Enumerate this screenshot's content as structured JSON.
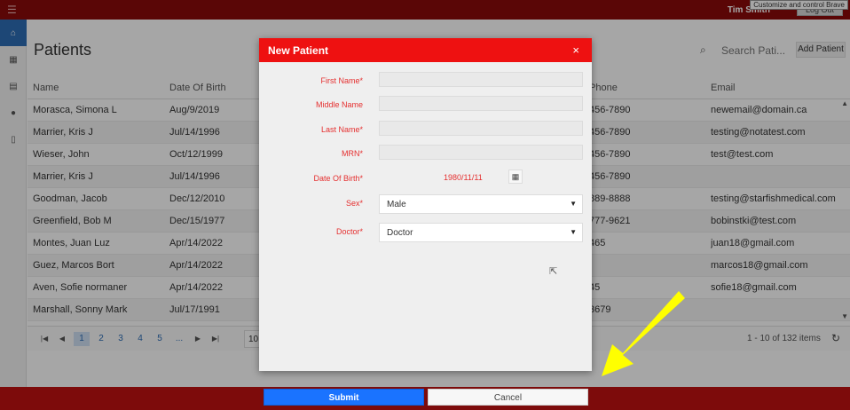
{
  "topbar": {
    "menu_icon": "hamburger-icon",
    "user_name": "Tim Smith",
    "logout_label": "Log Out",
    "tooltip": "Customize and control Brave",
    "color": "#8b0a0a"
  },
  "sidebar": {
    "items": [
      {
        "icon": "patients-icon",
        "glyph": "⌂",
        "active": true
      },
      {
        "icon": "calendar-icon",
        "glyph": "▦"
      },
      {
        "icon": "calculator-icon",
        "glyph": "▤"
      },
      {
        "icon": "user-icon",
        "glyph": "👤"
      },
      {
        "icon": "document-icon",
        "glyph": "▯"
      }
    ]
  },
  "main": {
    "title": "Patients",
    "search_placeholder": "Search Pati...",
    "add_patient_label": "Add Patient"
  },
  "grid": {
    "columns": {
      "name": "Name",
      "dob": "Date Of Birth",
      "phone": "Phone",
      "email": "Email"
    },
    "rows": [
      {
        "name": "Morasca, Simona L",
        "dob": "Aug/9/2019",
        "phone": "456-7890",
        "email": "newemail@domain.ca"
      },
      {
        "name": "Marrier, Kris J",
        "dob": "Jul/14/1996",
        "phone": "456-7890",
        "email": "testing@notatest.com"
      },
      {
        "name": "Wieser, John",
        "dob": "Oct/12/1999",
        "phone": "456-7890",
        "email": "test@test.com"
      },
      {
        "name": "Marrier, Kris J",
        "dob": "Jul/14/1996",
        "phone": "456-7890",
        "email": ""
      },
      {
        "name": "Goodman, Jacob",
        "dob": "Dec/12/2010",
        "phone": "889-8888",
        "email": "testing@starfishmedical.com"
      },
      {
        "name": "Greenfield, Bob M",
        "dob": "Dec/15/1977",
        "phone": "777-9621",
        "email": "bobinstki@test.com"
      },
      {
        "name": "Montes, Juan Luz",
        "dob": "Apr/14/2022",
        "phone": "465",
        "email": "juan18@gmail.com"
      },
      {
        "name": "Guez, Marcos Bort",
        "dob": "Apr/14/2022",
        "phone": "",
        "email": "marcos18@gmail.com"
      },
      {
        "name": "Aven, Sofie normaner",
        "dob": "Apr/14/2022",
        "phone": "45",
        "email": "sofie18@gmail.com"
      },
      {
        "name": "Marshall, Sonny Mark",
        "dob": "Jul/17/1991",
        "phone": "3679",
        "email": ""
      }
    ]
  },
  "pager": {
    "pages": [
      "1",
      "2",
      "3",
      "4",
      "5",
      "..."
    ],
    "page_size": "10",
    "info": "1 - 10 of 132 items"
  },
  "modal": {
    "title": "New Patient",
    "close": "×",
    "first_name_label": "First Name*",
    "middle_name_label": "Middle Name",
    "last_name_label": "Last Name*",
    "mrn_label": "MRN*",
    "dob_label": "Date Of Birth*",
    "dob_value": "1980/11/11",
    "sex_label": "Sex*",
    "sex_value": "Male",
    "doctor_label": "Doctor*",
    "doctor_value": "Doctor",
    "header_color": "#ee1111",
    "label_color": "#e53030"
  },
  "footer": {
    "submit_label": "Submit",
    "cancel_label": "Cancel",
    "submit_color": "#1a73ff"
  },
  "annotation": {
    "icon": "yellow-arrow-icon",
    "color": "#ffff00"
  }
}
